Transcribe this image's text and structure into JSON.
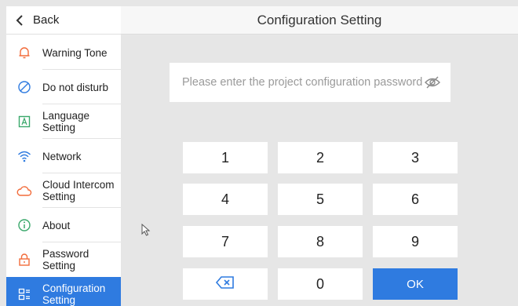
{
  "header": {
    "title": "Configuration Setting"
  },
  "sidebar": {
    "back_label": "Back",
    "items": [
      {
        "label": "Warning Tone",
        "icon": "bell-icon"
      },
      {
        "label": "Do not disturb",
        "icon": "no-disturb-icon"
      },
      {
        "label": "Language\nSetting",
        "icon": "language-icon"
      },
      {
        "label": "Network",
        "icon": "wifi-icon"
      },
      {
        "label": "Cloud Intercom\nSetting",
        "icon": "cloud-icon"
      },
      {
        "label": "About",
        "icon": "info-icon"
      },
      {
        "label": "Password\nSetting",
        "icon": "lock-icon"
      },
      {
        "label": "Configuration\nSetting",
        "icon": "configuration-icon",
        "active": true
      }
    ]
  },
  "password": {
    "placeholder": "Please enter the project configuration password",
    "value": ""
  },
  "keypad": {
    "keys": [
      "1",
      "2",
      "3",
      "4",
      "5",
      "6",
      "7",
      "8",
      "9",
      "0"
    ],
    "delete_icon": "backspace-icon",
    "ok_label": "OK"
  },
  "colors": {
    "accent": "#2f7be0",
    "icon_orange": "#f26b3a",
    "icon_blue": "#2f7be0",
    "icon_green": "#3aa86b"
  }
}
